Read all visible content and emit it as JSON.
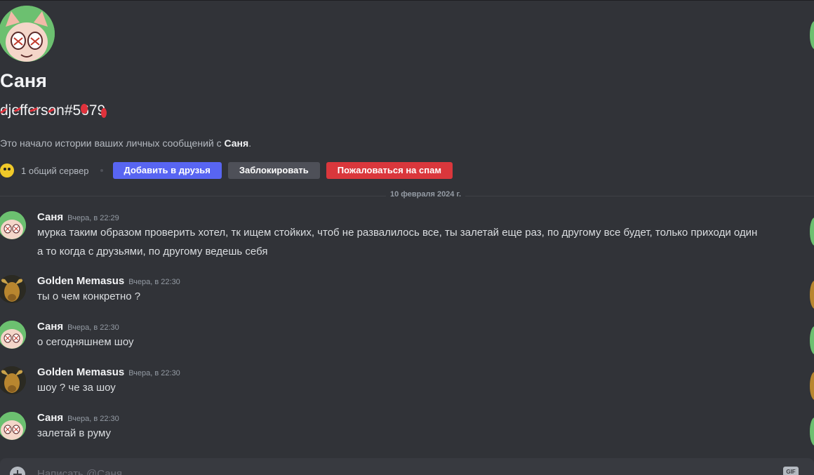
{
  "profile": {
    "name": "Саня",
    "handle": "djefferson#5679",
    "intro_prefix": "Это начало истории ваших личных сообщений с ",
    "intro_name": "Саня",
    "intro_suffix": ".",
    "mutual_servers": "1 общий сервер"
  },
  "actions": {
    "add_friend": "Добавить в друзья",
    "block": "Заблокировать",
    "report_spam": "Пожаловаться на спам"
  },
  "date_divider": "10 февраля 2024 г.",
  "messages": [
    {
      "author": "Саня",
      "time": "Вчера, в 22:29",
      "lines": [
        "мурка таким образом проверить хотел, тк ищем стойких, чтоб не развалилось все, ты залетай еще раз, по другому все будет, только приходи один",
        "а то когда с друзьями, по другому ведешь себя"
      ]
    },
    {
      "author": "Golden Memasus",
      "time": "Вчера, в 22:30",
      "lines": [
        "ты о чем конкретно ?"
      ]
    },
    {
      "author": "Саня",
      "time": "Вчера, в 22:30",
      "lines": [
        "о сегодняшнем шоу"
      ]
    },
    {
      "author": "Golden Memasus",
      "time": "Вчера, в 22:30",
      "lines": [
        "шоу ? че за шоу"
      ]
    },
    {
      "author": "Саня",
      "time": "Вчера, в 22:30",
      "lines": [
        "залетай в руму"
      ]
    }
  ],
  "composer": {
    "placeholder": "Написать @Саня",
    "gif_label": "GIF"
  },
  "colors": {
    "background": "#313338",
    "accent_blurple": "#5865f2",
    "danger_red": "#da373c",
    "secondary_gray": "#4e5058"
  },
  "icons": [
    "add-attachment-icon",
    "gif-icon",
    "server-icon"
  ]
}
